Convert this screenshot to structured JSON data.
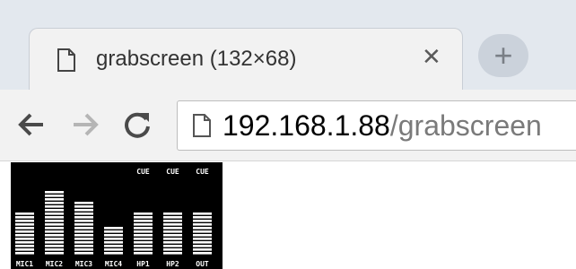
{
  "browser": {
    "tab": {
      "title": "grabscreen (132×68)",
      "close_icon": "close-icon",
      "page_icon": "page-icon"
    },
    "new_tab_label": "+",
    "toolbar": {
      "back_icon": "back-arrow-icon",
      "forward_icon": "forward-arrow-icon",
      "reload_icon": "reload-icon"
    },
    "omnibox": {
      "host": "192.168.1.88",
      "path": "/grabscreen"
    }
  },
  "grabscreen": {
    "channels": [
      {
        "label": "MIC1",
        "level": 0.5,
        "cue": ""
      },
      {
        "label": "MIC2",
        "level": 0.8,
        "cue": ""
      },
      {
        "label": "MIC3",
        "level": 0.65,
        "cue": ""
      },
      {
        "label": "MIC4",
        "level": 0.35,
        "cue": ""
      },
      {
        "label": "HP1",
        "level": 0.5,
        "cue": "CUE"
      },
      {
        "label": "HP2",
        "level": 0.5,
        "cue": "CUE"
      },
      {
        "label": "OUT",
        "level": 0.5,
        "cue": "CUE"
      }
    ],
    "colors": {
      "background": "#000000",
      "foreground": "#ffffff"
    }
  }
}
